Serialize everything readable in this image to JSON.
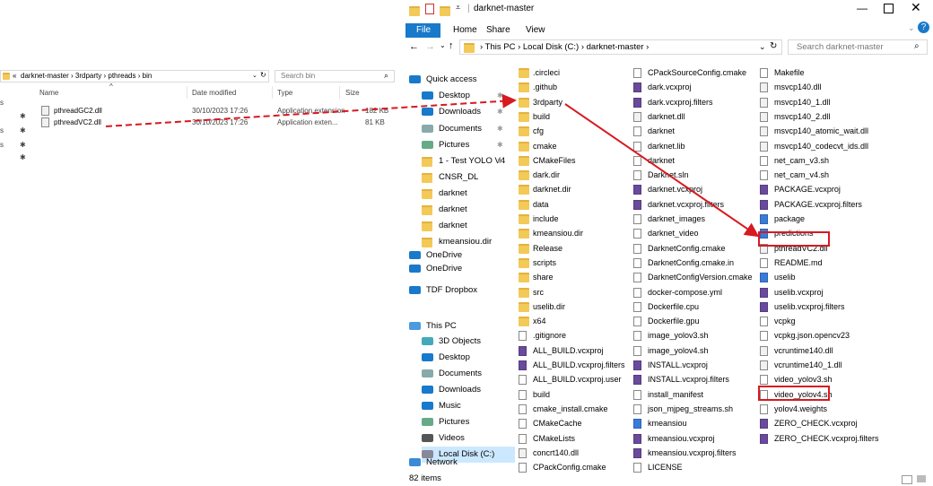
{
  "left_window": {
    "breadcrumb": [
      "darknet-master",
      "3rdparty",
      "pthreads",
      "bin"
    ],
    "search_placeholder": "Search bin",
    "columns": [
      "Name",
      "Date modified",
      "Type",
      "Size"
    ],
    "rows": [
      {
        "name": "pthreadGC2.dll",
        "date": "30/10/2023 17:26",
        "type": "Application extension",
        "size": "182 KB"
      },
      {
        "name": "pthreadVC2.dll",
        "date": "30/10/2023 17:26",
        "type": "Application exten...",
        "size": "81 KB"
      }
    ],
    "sidebar_fragments": [
      "s",
      "s",
      "s"
    ]
  },
  "right_window": {
    "title": "darknet-master",
    "ribbon_tabs": [
      "File",
      "Home",
      "Share",
      "View"
    ],
    "breadcrumb": [
      "This PC",
      "Local Disk (C:)",
      "darknet-master"
    ],
    "search_placeholder": "Search darknet-master",
    "status": "82 items",
    "nav": [
      {
        "label": "Quick access",
        "icon": "star-icon"
      },
      {
        "label": "Desktop",
        "icon": "desktop-icon",
        "pin": true
      },
      {
        "label": "Downloads",
        "icon": "download-icon",
        "pin": true
      },
      {
        "label": "Documents",
        "icon": "documents-icon",
        "pin": true
      },
      {
        "label": "Pictures",
        "icon": "pictures-icon",
        "pin": true
      },
      {
        "label": "1 - Test YOLO V4",
        "icon": "folder-icon",
        "pin": true
      },
      {
        "label": "CNSR_DL",
        "icon": "folder-icon"
      },
      {
        "label": "darknet",
        "icon": "folder-icon"
      },
      {
        "label": "darknet",
        "icon": "folder-icon"
      },
      {
        "label": "darknet",
        "icon": "folder-icon"
      },
      {
        "label": "kmeansiou.dir",
        "icon": "folder-icon"
      },
      {
        "label": "OneDrive",
        "icon": "cloud-icon"
      },
      {
        "label": "OneDrive",
        "icon": "cloud-icon"
      },
      {
        "label": "TDF Dropbox",
        "icon": "dropbox-icon"
      },
      {
        "label": "This PC",
        "icon": "pc-icon"
      },
      {
        "label": "3D Objects",
        "icon": "cube-icon"
      },
      {
        "label": "Desktop",
        "icon": "desktop-icon"
      },
      {
        "label": "Documents",
        "icon": "documents-icon"
      },
      {
        "label": "Downloads",
        "icon": "download-icon"
      },
      {
        "label": "Music",
        "icon": "music-icon"
      },
      {
        "label": "Pictures",
        "icon": "pictures-icon"
      },
      {
        "label": "Videos",
        "icon": "video-icon"
      },
      {
        "label": "Local Disk (C:)",
        "icon": "drive-icon"
      },
      {
        "label": "Network",
        "icon": "network-icon"
      }
    ],
    "col1": [
      ".circleci",
      ".github",
      "3rdparty",
      "build",
      "cfg",
      "cmake",
      "CMakeFiles",
      "dark.dir",
      "darknet.dir",
      "data",
      "include",
      "kmeansiou.dir",
      "Release",
      "scripts",
      "share",
      "src",
      "uselib.dir",
      "x64",
      ".gitignore",
      "ALL_BUILD.vcxproj",
      "ALL_BUILD.vcxproj.filters",
      "ALL_BUILD.vcxproj.user",
      "build",
      "cmake_install.cmake",
      "CMakeCache",
      "CMakeLists",
      "concrt140.dll",
      "CPackConfig.cmake"
    ],
    "col2": [
      "CPackSourceConfig.cmake",
      "dark.vcxproj",
      "dark.vcxproj.filters",
      "darknet.dll",
      "darknet",
      "darknet.lib",
      "darknet",
      "Darknet.sln",
      "darknet.vcxproj",
      "darknet.vcxproj.filters",
      "darknet_images",
      "darknet_video",
      "DarknetConfig.cmake",
      "DarknetConfig.cmake.in",
      "DarknetConfigVersion.cmake",
      "docker-compose.yml",
      "Dockerfile.cpu",
      "Dockerfile.gpu",
      "image_yolov3.sh",
      "image_yolov4.sh",
      "INSTALL.vcxproj",
      "INSTALL.vcxproj.filters",
      "install_manifest",
      "json_mjpeg_streams.sh",
      "kmeansiou",
      "kmeansiou.vcxproj",
      "kmeansiou.vcxproj.filters",
      "LICENSE"
    ],
    "col3": [
      "Makefile",
      "msvcp140.dll",
      "msvcp140_1.dll",
      "msvcp140_2.dll",
      "msvcp140_atomic_wait.dll",
      "msvcp140_codecvt_ids.dll",
      "net_cam_v3.sh",
      "net_cam_v4.sh",
      "PACKAGE.vcxproj",
      "PACKAGE.vcxproj.filters",
      "package",
      "predictions",
      "pthreadVC2.dll",
      "README.md",
      "uselib",
      "uselib.vcxproj",
      "uselib.vcxproj.filters",
      "vcpkg",
      "vcpkg.json.opencv23",
      "vcruntime140.dll",
      "vcruntime140_1.dll",
      "video_yolov3.sh",
      "video_yolov4.sh",
      "yolov4.weights",
      "ZERO_CHECK.vcxproj",
      "ZERO_CHECK.vcxproj.filters"
    ]
  },
  "colors": {
    "accent": "#1979ca",
    "highlight": "#d71920",
    "folder": "#f3c958"
  }
}
